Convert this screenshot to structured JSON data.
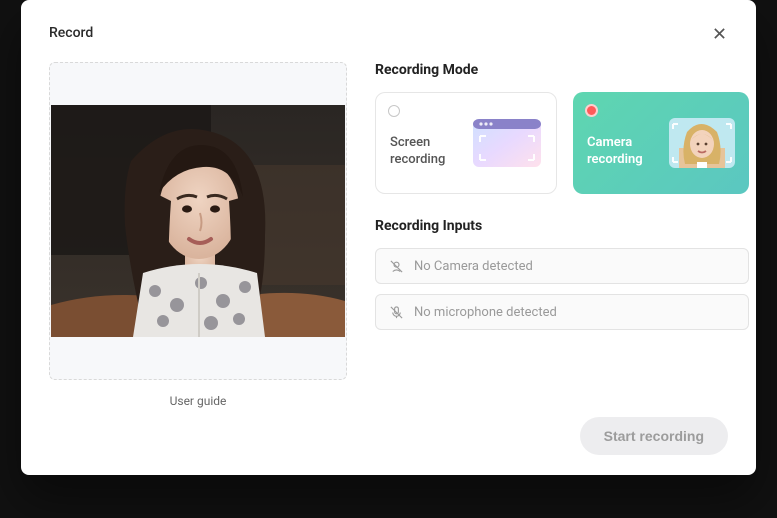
{
  "modal": {
    "title": "Record"
  },
  "preview": {
    "user_guide_label": "User guide"
  },
  "sections": {
    "mode_heading": "Recording Mode",
    "inputs_heading": "Recording Inputs"
  },
  "modes": {
    "screen": {
      "label": "Screen recording",
      "selected": false
    },
    "camera": {
      "label": "Camera recording",
      "selected": true
    }
  },
  "inputs": {
    "camera": "No Camera detected",
    "microphone": "No microphone detected"
  },
  "footer": {
    "start_label": "Start recording"
  }
}
